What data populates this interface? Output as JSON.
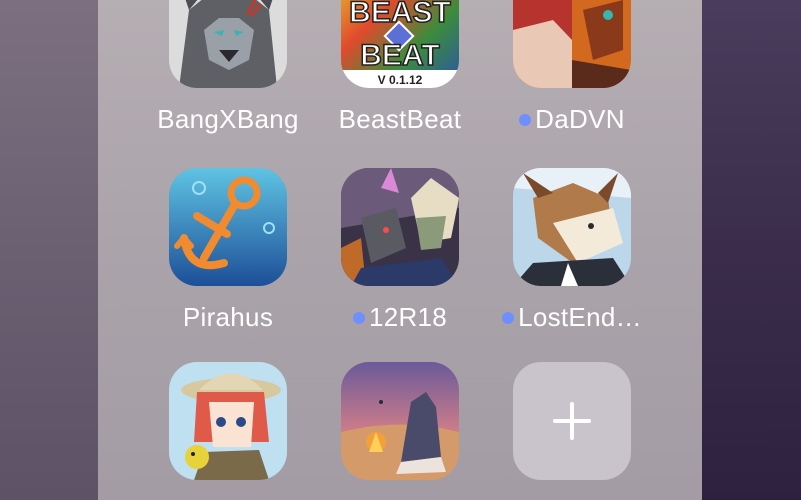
{
  "apps": [
    {
      "name": "BangXBang",
      "dot": false,
      "icon": "wolf-character-icon"
    },
    {
      "name": "BeastBeat",
      "dot": false,
      "icon": "beastbeat-logo-icon",
      "logo_top": "BEAST",
      "logo_bottom": "BEAT",
      "version": "V 0.1.12"
    },
    {
      "name": "DaDVN",
      "dot": true,
      "icon": "dragon-character-icon"
    },
    {
      "name": "Pirahus",
      "dot": false,
      "icon": "anchor-icon"
    },
    {
      "name": "12R18",
      "dot": true,
      "icon": "group-characters-icon"
    },
    {
      "name": "LostEnd…",
      "dot": true,
      "icon": "horned-character-icon"
    },
    {
      "name": "",
      "dot": false,
      "icon": "explorer-girl-icon"
    },
    {
      "name": "",
      "dot": false,
      "icon": "beach-sunset-icon"
    },
    {
      "name": "",
      "dot": false,
      "icon": "add-icon"
    }
  ],
  "colors": {
    "dot": "#6f8fff",
    "panel": "#aaa3aa",
    "add_tile": "#c9c4cb"
  }
}
